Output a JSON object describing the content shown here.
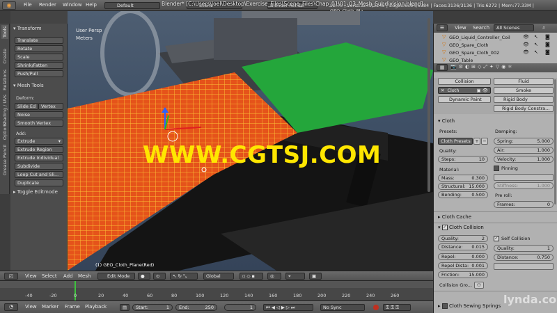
{
  "topbar": {
    "menu": [
      "File",
      "Render",
      "Window",
      "Help"
    ],
    "screen": "Default",
    "scene": "Scene",
    "engine": "Blender Render",
    "title": "Blender* [C:\\Users\\Joel\\Desktop\\Exercise_Files\\Scene_Files\\Chap_01\\01_03_Mesh_Subdivision.blend]",
    "stats": "v2.70 | Verts:3249/3249 | Edges:6384/6384 | Faces:3136/3136 | Tris:6272 | Mem:77.33M | GEO_Cloth_Pla"
  },
  "left_tabs": [
    "Tools",
    "Create",
    "Relations",
    "Shading / UVs",
    "Options",
    "Grease Pencil"
  ],
  "toolshelf": {
    "transform_header": "Transform",
    "transform": [
      "Translate",
      "Rotate",
      "Scale",
      "Shrink/Fatten",
      "Push/Pull"
    ],
    "mesh_tools_header": "Mesh Tools",
    "deform_label": "Deform:",
    "slide_edge": "Slide Ed",
    "vertex": "Vertex",
    "noise": "Noise",
    "smooth_vertex": "Smooth Vertex",
    "add_label": "Add:",
    "add": [
      "Extrude",
      "Extrude Region",
      "Extrude Individual",
      "Subdivide",
      "Loop Cut and Sli...",
      "Duplicate"
    ],
    "toggle_editmode": "Toggle Editmode"
  },
  "viewport": {
    "view_name": "User Persp",
    "units": "Meters",
    "object_label": "(1) GEO_Cloth_Plane(Red)",
    "watermark": "WWW.CGTSJ.COM"
  },
  "view3d_header": {
    "view": "View",
    "select": "Select",
    "add": "Add",
    "mesh": "Mesh",
    "mode": "Edit Mode",
    "orientation": "Global"
  },
  "timeline": {
    "ticks": [
      "-40",
      "-20",
      "0",
      "20",
      "40",
      "60",
      "80",
      "100",
      "120",
      "140",
      "160",
      "180",
      "200",
      "220",
      "240",
      "260"
    ],
    "menu": [
      "View",
      "Marker",
      "Frame",
      "Playback"
    ],
    "start_label": "Start:",
    "start": "1",
    "end_label": "End:",
    "end": "250",
    "current": "1",
    "sync": "No Sync"
  },
  "outliner": {
    "view": "View",
    "search": "Search",
    "filter": "All Scenes",
    "items": [
      "GEO_Liquid_Controller_Coil",
      "GEO_Spare_Cloth",
      "GEO_Spare_Cloth_002",
      "GEO_Table"
    ]
  },
  "physics": {
    "buttons_left": [
      "Collision",
      "Cloth",
      "Dynamic Paint"
    ],
    "buttons_right": [
      "Fluid",
      "Smoke",
      "Rigid Body",
      "Rigid Body Constra..."
    ],
    "cloth_header": "Cloth",
    "presets_label": "Presets:",
    "presets_value": "Cloth Presets",
    "quality_label": "Quality:",
    "steps_label": "Steps:",
    "steps": "10",
    "material_label": "Material:",
    "mass_label": "Mass:",
    "mass": "0.300",
    "structural_label": "Structural:",
    "structural": "15.000",
    "bending_label": "Bending:",
    "bending": "0.500",
    "damping_label": "Damping:",
    "spring_label": "Spring:",
    "spring": "5.000",
    "air_label": "Air:",
    "air": "1.000",
    "velocity_label": "Velocity:",
    "velocity": "1.000",
    "pinning": "Pinning",
    "stiffness_label": "Stiffness:",
    "stiffness": "1.000",
    "preroll_label": "Pre roll:",
    "frames_label": "Frames:",
    "frames": "0",
    "cloth_cache": "Cloth Cache",
    "cloth_collision": "Cloth Collision",
    "coll_quality_label": "Quality:",
    "coll_quality": "2",
    "distance_label": "Distance:",
    "distance": "0.015",
    "repel_label": "Repel:",
    "repel": "0.000",
    "repel_dist_label": "Repel Dista:",
    "repel_dist": "0.001",
    "friction_label": "Friction:",
    "friction": "15.000",
    "self_collision": "Self Collision",
    "self_quality_label": "Quality:",
    "self_quality": "1",
    "self_distance_label": "Distance:",
    "self_distance": "0.750",
    "collision_group": "Collision Gro...",
    "sewing": "Cloth Sewing Springs"
  },
  "brand": "lynda.com",
  "colors": {
    "cloth_orange": "#e5531a",
    "cloth_grid": "#ffd23a",
    "green_plane": "#24a63b",
    "watermark": "#ffe600"
  }
}
